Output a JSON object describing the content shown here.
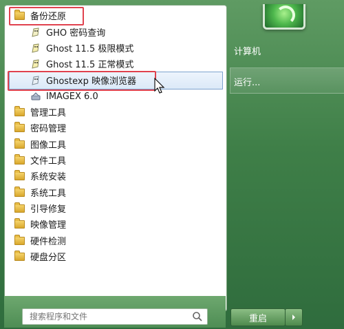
{
  "menu": {
    "expanded_folder": {
      "label": "备份还原",
      "icon": "folder-icon"
    },
    "sub_items": [
      {
        "label": "GHO 密码查询",
        "icon": "ghost-icon"
      },
      {
        "label": "Ghost 11.5 极限模式",
        "icon": "ghost-icon"
      },
      {
        "label": "Ghost 11.5 正常模式",
        "icon": "ghost-icon"
      },
      {
        "label": "Ghostexp 映像浏览器",
        "icon": "ghost-icon",
        "selected": true
      },
      {
        "label": "IMAGEX 6.0",
        "icon": "imagex-icon"
      }
    ],
    "folders": [
      {
        "label": "管理工具"
      },
      {
        "label": "密码管理"
      },
      {
        "label": "图像工具"
      },
      {
        "label": "文件工具"
      },
      {
        "label": "系统安装"
      },
      {
        "label": "系统工具"
      },
      {
        "label": "引导修复"
      },
      {
        "label": "映像管理"
      },
      {
        "label": "硬件检测"
      },
      {
        "label": "硬盘分区"
      }
    ]
  },
  "right_pane": {
    "computer_label": "计算机",
    "run_label": "运行..."
  },
  "search": {
    "placeholder": "搜索程序和文件"
  },
  "restart_button": {
    "label": "重启"
  },
  "colors": {
    "highlight_border": "#e0414d",
    "accent": "#4e8d54"
  }
}
